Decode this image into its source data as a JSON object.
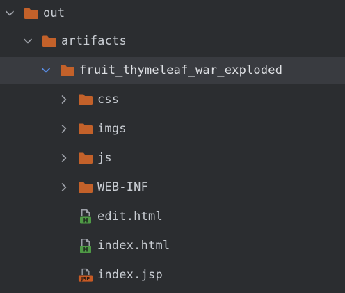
{
  "tree": {
    "rows": [
      {
        "label": "out",
        "kind": "folder",
        "expanded": true,
        "depth": 0
      },
      {
        "label": "artifacts",
        "kind": "folder",
        "expanded": true,
        "depth": 1
      },
      {
        "label": "fruit_thymeleaf_war_exploded",
        "kind": "folder",
        "expanded": true,
        "depth": 2,
        "selected": true
      },
      {
        "label": "css",
        "kind": "folder",
        "expanded": false,
        "depth": 3
      },
      {
        "label": "imgs",
        "kind": "folder",
        "expanded": false,
        "depth": 3
      },
      {
        "label": "js",
        "kind": "folder",
        "expanded": false,
        "depth": 3
      },
      {
        "label": "WEB-INF",
        "kind": "folder",
        "expanded": false,
        "depth": 3
      },
      {
        "label": "edit.html",
        "kind": "html-file",
        "badge": "H",
        "depth": 3
      },
      {
        "label": "index.html",
        "kind": "html-file",
        "badge": "H",
        "depth": 3
      },
      {
        "label": "index.jsp",
        "kind": "jsp-file",
        "badge": "JSP",
        "depth": 3
      }
    ]
  },
  "colors": {
    "background": "#2b2d30",
    "selection": "#393b40",
    "folder": "#c3612a",
    "html_badge": "#4f9a46",
    "jsp_badge": "#c75a24",
    "chevron": "#9da0a8",
    "chevron_selected": "#5a8de6",
    "text": "#c9cdd3"
  },
  "icons": {
    "expanded": "chevron-down-icon",
    "collapsed": "chevron-right-icon",
    "folder": "folder-icon",
    "html": "html-file-icon",
    "jsp": "jsp-file-icon"
  }
}
